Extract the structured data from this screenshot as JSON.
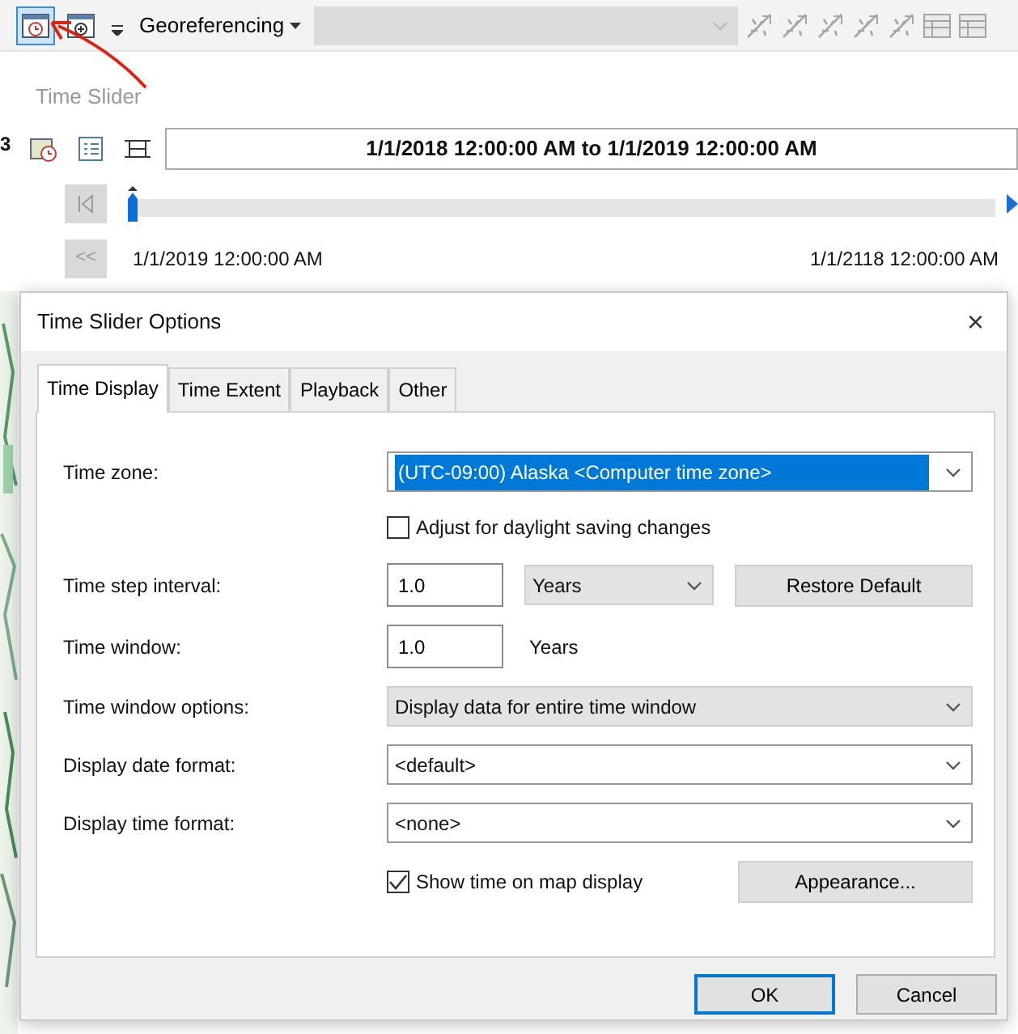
{
  "toolbar": {
    "buttons": [
      {
        "kind": "clock",
        "pressed": true
      },
      {
        "kind": "zoom",
        "pressed": false
      }
    ],
    "menu": "Georeferencing",
    "layer_combo": {
      "disabled": true
    },
    "tools": [
      {
        "kind": "link",
        "disabled": true
      },
      {
        "kind": "link",
        "disabled": true
      },
      {
        "kind": "link",
        "disabled": true
      },
      {
        "kind": "link",
        "disabled": true
      },
      {
        "kind": "link",
        "disabled": true
      },
      {
        "kind": "table",
        "disabled": true
      },
      {
        "kind": "table",
        "disabled": true
      }
    ]
  },
  "edge_label": "3",
  "time_slider": {
    "title": "Time Slider",
    "extent": "1/1/2018 12:00:00 AM to 1/1/2019 12:00:00 AM",
    "level": 0,
    "start": "1/1/2019 12:00:00 AM",
    "end": "1/1/2118 12:00:00 AM",
    "back_button": "<<"
  },
  "dialog": {
    "title": "Time Slider Options",
    "close": "×",
    "tabs": [
      {
        "label": "Time Display",
        "selected": true
      },
      {
        "label": "Time Extent",
        "selected": false
      },
      {
        "label": "Playback",
        "selected": false
      },
      {
        "label": "Other",
        "selected": false
      }
    ],
    "rows": [
      {
        "kind": "select",
        "label": "Time zone:",
        "value": "(UTC-09:00) Alaska <Computer time zone>",
        "editable": true,
        "highlighted": true
      },
      {
        "kind": "checkbox",
        "label": "Adjust for daylight saving changes",
        "checked": false
      },
      {
        "kind": "step",
        "label": "Time step interval:",
        "value": "1.0",
        "unit": "Years",
        "button": "Restore Default"
      },
      {
        "kind": "number",
        "label": "Time window:",
        "value": "1.0",
        "unit": "Years"
      },
      {
        "kind": "select",
        "label": "Time window options:",
        "value": "Display data for entire time window",
        "editable": false,
        "highlighted": false
      },
      {
        "kind": "select",
        "label": "Display date format:",
        "value": "<default>",
        "editable": true,
        "highlighted": false
      },
      {
        "kind": "select",
        "label": "Display time format:",
        "value": "<none>",
        "editable": true,
        "highlighted": false
      },
      {
        "kind": "checkbox_button",
        "label": "Show time on map display",
        "checked": true,
        "button": "Appearance..."
      }
    ],
    "buttons": [
      {
        "label": "OK",
        "default": true
      },
      {
        "label": "Cancel",
        "default": false
      }
    ]
  }
}
